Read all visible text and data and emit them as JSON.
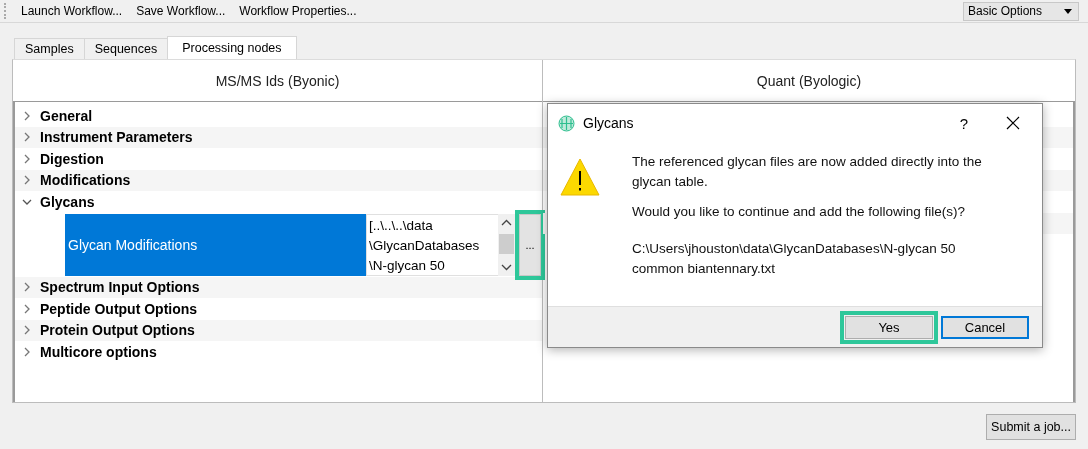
{
  "toolbar": {
    "buttons": [
      "Launch Workflow...",
      "Save Workflow...",
      "Workflow Properties..."
    ],
    "options_dropdown": {
      "value": "Basic Options"
    }
  },
  "tabs": [
    {
      "label": "Samples",
      "selected": false
    },
    {
      "label": "Sequences",
      "selected": false
    },
    {
      "label": "Processing nodes",
      "selected": true
    }
  ],
  "panels": [
    {
      "title": "MS/MS Ids (Byonic)",
      "tree": [
        {
          "label": "General",
          "expanded": false
        },
        {
          "label": "Instrument Parameters",
          "expanded": false
        },
        {
          "label": "Digestion",
          "expanded": false
        },
        {
          "label": "Modifications",
          "expanded": false
        },
        {
          "label": "Glycans",
          "expanded": true,
          "children": [
            {
              "label": "Glycan Modifications",
              "selected": true,
              "value_lines": [
                "[..\\..\\..\\data",
                "\\GlycanDatabases",
                "\\N-glycan 50"
              ],
              "browse_button": {
                "label": "...",
                "highlighted": true
              }
            }
          ]
        },
        {
          "label": "Spectrum Input Options",
          "expanded": false
        },
        {
          "label": "Peptide Output Options",
          "expanded": false
        },
        {
          "label": "Protein Output Options",
          "expanded": false
        },
        {
          "label": "Multicore options",
          "expanded": false
        }
      ]
    },
    {
      "title": "Quant (Byologic)"
    }
  ],
  "dialog": {
    "title": "Glycans",
    "help": "?",
    "message": "The referenced glycan files are now added directly into the glycan table.",
    "question": "Would you like to continue and add the following file(s)?",
    "file_path": "C:\\Users\\jhouston\\data\\GlycanDatabases\\N-glycan 50 common biantennary.txt",
    "buttons": [
      {
        "label": "Yes",
        "highlighted": true,
        "focused": false
      },
      {
        "label": "Cancel",
        "highlighted": false,
        "focused": true
      }
    ]
  },
  "submit_button": "Submit a job..."
}
